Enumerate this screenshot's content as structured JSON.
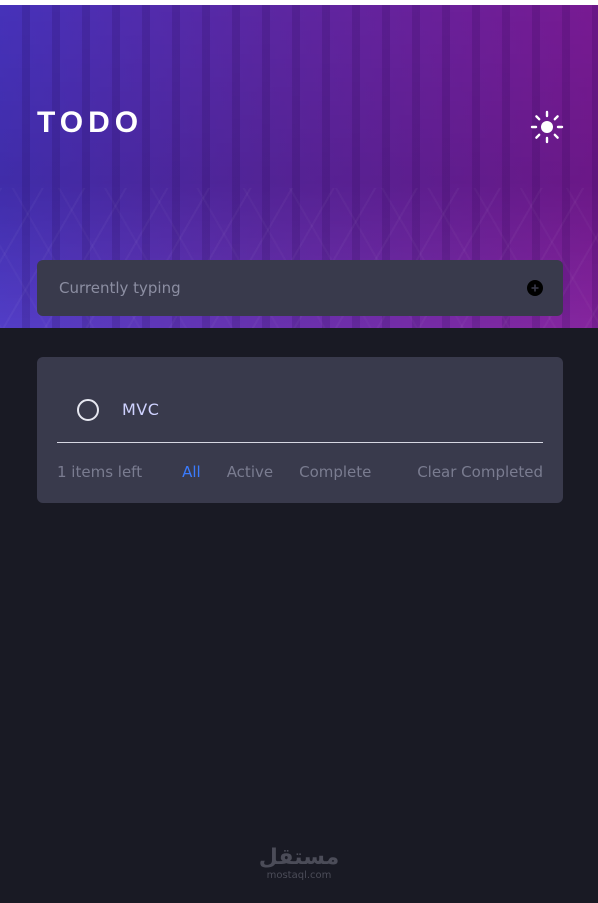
{
  "header": {
    "title": "TODO",
    "theme_icon": "sun-icon"
  },
  "new_todo": {
    "placeholder": "Currently typing",
    "add_icon": "plus-circle-icon"
  },
  "todos": [
    {
      "text": "MVC",
      "completed": false
    }
  ],
  "footer": {
    "items_left": "1 items left",
    "filters": [
      "All",
      "Active",
      "Complete"
    ],
    "active_filter": "All",
    "clear_label": "Clear Completed"
  },
  "watermark": {
    "arabic": "مستقل",
    "latin": "mostaql.com"
  },
  "colors": {
    "background": "#191a24",
    "card": "#393a4c",
    "accent": "#3a7bfd",
    "muted_text": "#7a7c90"
  }
}
